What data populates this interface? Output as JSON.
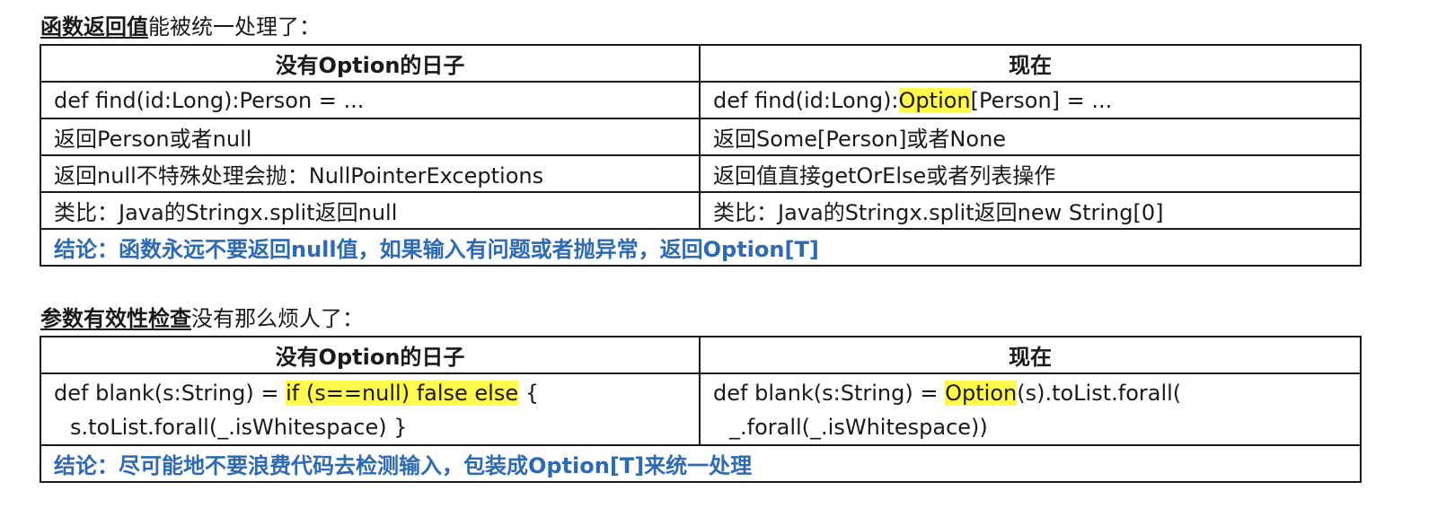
{
  "section1": {
    "title_key": "函数返回值",
    "title_rest": "能被统一处理了：",
    "headers": [
      "没有Option的日子",
      "现在"
    ],
    "rows": [
      {
        "left": "def find(id:Long):Person = ...",
        "right_pre": "def find(id:Long):",
        "right_hl": "Option",
        "right_post": "[Person] = ..."
      },
      {
        "left": "返回Person或者null",
        "right_pre": "返回Some[Person]或者None",
        "right_hl": "",
        "right_post": ""
      },
      {
        "left": "返回null不特殊处理会抛：NullPointerExceptions",
        "right_pre": "返回值直接getOrElse或者列表操作",
        "right_hl": "",
        "right_post": ""
      },
      {
        "left": "类比：Java的Stringx.split返回null",
        "right_pre": "类比：Java的Stringx.split返回new String[0]",
        "right_hl": "",
        "right_post": ""
      }
    ],
    "conclusion": "结论：函数永远不要返回null值，如果输入有问题或者抛异常，返回Option[T]"
  },
  "section2": {
    "title_key": "参数有效性检查",
    "title_rest": "没有那么烦人了：",
    "headers": [
      "没有Option的日子",
      "现在"
    ],
    "left_line1_pre": "def blank(s:String) = ",
    "left_line1_hl": "if (s==null) false else",
    "left_line1_post": " {",
    "left_line2": "s.toList.forall(_.isWhitespace) }",
    "right_line1_pre": "def blank(s:String) = ",
    "right_line1_hl": "Option",
    "right_line1_post": "(s).toList.forall(",
    "right_line2": "_.forall(_.isWhitespace))",
    "conclusion": "结论：尽可能地不要浪费代码去检测输入，包装成Option[T]来统一处理"
  },
  "colors": {
    "highlight": "#fff94d",
    "conclusion": "#2e6ab3",
    "border": "#1a1a1a"
  }
}
